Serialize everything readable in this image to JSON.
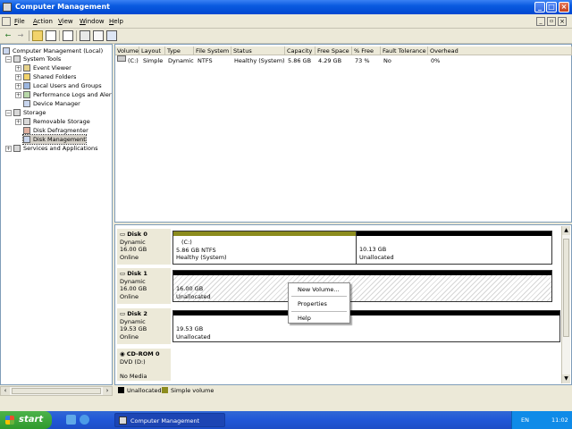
{
  "window": {
    "title": "Computer Management",
    "controls": {
      "minimize": "_",
      "maximize": "□",
      "close": "×"
    }
  },
  "menu": {
    "items": [
      {
        "label": "File",
        "accel": "F",
        "rest": "ile"
      },
      {
        "label": "Action",
        "accel": "A",
        "rest": "ction"
      },
      {
        "label": "View",
        "accel": "V",
        "rest": "iew"
      },
      {
        "label": "Window",
        "accel": "W",
        "rest": "indow"
      },
      {
        "label": "Help",
        "accel": "H",
        "rest": "elp"
      }
    ]
  },
  "toolbar": {
    "back": "←",
    "forward": "→"
  },
  "tree": {
    "root": "Computer Management (Local)",
    "system_tools": "System Tools",
    "event_viewer": "Event Viewer",
    "shared_folders": "Shared Folders",
    "local_users": "Local Users and Groups",
    "perf_logs": "Performance Logs and Alerts",
    "device_manager": "Device Manager",
    "storage": "Storage",
    "removable_storage": "Removable Storage",
    "disk_defrag": "Disk Defragmenter",
    "disk_mgmt": "Disk Management",
    "services": "Services and Applications"
  },
  "volumes": {
    "columns": [
      "Volume",
      "Layout",
      "Type",
      "File System",
      "Status",
      "Capacity",
      "Free Space",
      "% Free",
      "Fault Tolerance",
      "Overhead"
    ],
    "rows": [
      {
        "volume": "(C:)",
        "layout": "Simple",
        "type": "Dynamic",
        "fs": "NTFS",
        "status": "Healthy (System)",
        "capacity": "5.86 GB",
        "free": "4.29 GB",
        "pct": "73 %",
        "fault": "No",
        "overhead": "0%"
      }
    ]
  },
  "disks": [
    {
      "name": "Disk 0",
      "type": "Dynamic",
      "size": "16.00 GB",
      "status": "Online",
      "parts": [
        {
          "label": "(C:)",
          "line1": "5.86 GB NTFS",
          "line2": "Healthy (System)"
        },
        {
          "label": "",
          "line1": "10.13 GB",
          "line2": "Unallocated"
        }
      ]
    },
    {
      "name": "Disk 1",
      "type": "Dynamic",
      "size": "16.00 GB",
      "status": "Online",
      "parts": [
        {
          "label": "",
          "line1": "16.00 GB",
          "line2": "Unallocated"
        }
      ]
    },
    {
      "name": "Disk 2",
      "type": "Dynamic",
      "size": "19.53 GB",
      "status": "Online",
      "parts": [
        {
          "label": "",
          "line1": "19.53 GB",
          "line2": "Unallocated"
        }
      ]
    },
    {
      "name": "CD-ROM 0",
      "type": "DVD (D:)",
      "size": "",
      "status": "No Media",
      "parts": []
    }
  ],
  "context_menu": {
    "new_volume": "New Volume...",
    "properties": "Properties",
    "help": "Help"
  },
  "legend": {
    "unallocated": "Unallocated",
    "simple_volume": "Simple volume"
  },
  "colors": {
    "unallocated": "#000000",
    "simple_volume": "#8C8C1E"
  },
  "taskbar": {
    "start": "start",
    "task": "Computer Management",
    "lang": "EN",
    "clock": "11:02"
  }
}
